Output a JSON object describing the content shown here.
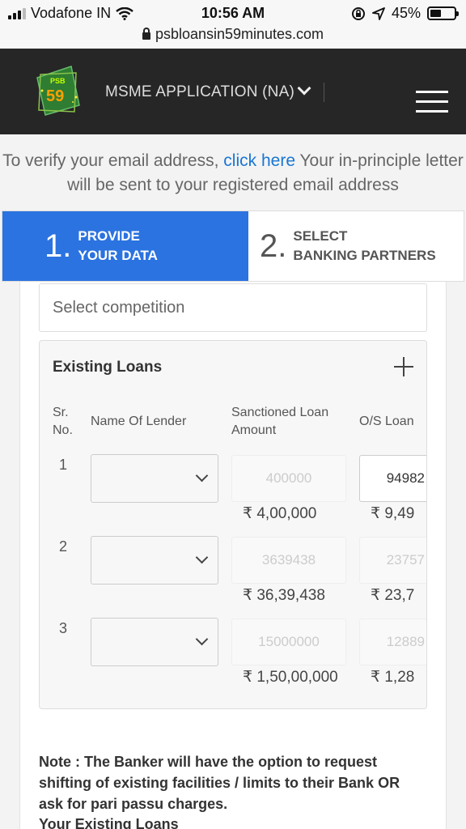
{
  "status_bar": {
    "carrier": "Vodafone IN",
    "time": "10:56 AM",
    "battery": "45%",
    "battery_level": 0.45
  },
  "browser": {
    "url": "psbloansin59minutes.com"
  },
  "header": {
    "logo_psb": "PSB",
    "logo_59": "59",
    "app_title": "MSME APPLICATION (NA)"
  },
  "verify": {
    "prefix": "To verify your email address,",
    "link": "click here",
    "suffix": "Your in-principle letter will be sent to your registered email address"
  },
  "steps": [
    {
      "num": "1.",
      "line1": "PROVIDE",
      "line2": "YOUR DATA"
    },
    {
      "num": "2.",
      "line1": "SELECT",
      "line2": "BANKING PARTNERS"
    }
  ],
  "select_competition": {
    "placeholder": "Select competition"
  },
  "existing_loans": {
    "title": "Existing Loans",
    "headers": {
      "sr_line1": "Sr.",
      "sr_line2": "No.",
      "lender": "Name Of Lender",
      "sanctioned_line1": "Sanctioned Loan",
      "sanctioned_line2": "Amount",
      "os": "O/S Loan"
    },
    "rows": [
      {
        "sr": "1",
        "sanctioned": "400000",
        "sanctioned_fmt": "₹ 4,00,000",
        "os": "94982",
        "os_fmt": "₹ 9,49"
      },
      {
        "sr": "2",
        "sanctioned": "3639438",
        "sanctioned_fmt": "₹ 36,39,438",
        "os": "23757",
        "os_fmt": "₹ 23,7"
      },
      {
        "sr": "3",
        "sanctioned": "15000000",
        "sanctioned_fmt": "₹ 1,50,00,000",
        "os": "12889",
        "os_fmt": "₹ 1,28"
      }
    ]
  },
  "note": "Note : The Banker will have the option to request shifting of existing facilities / limits to their Bank OR ask for pari passu charges.",
  "your_existing_loans": "Your Existing Loans"
}
